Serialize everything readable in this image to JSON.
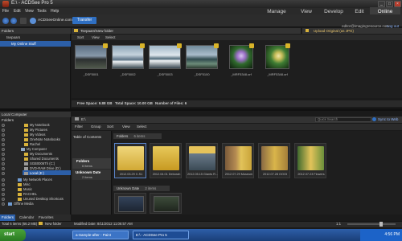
{
  "window": {
    "title": "E:\\ - ACDSee Pro 5"
  },
  "menu": [
    "File",
    "Edit",
    "View",
    "Tools",
    "Help"
  ],
  "modes": [
    "Manage",
    "View",
    "Develop",
    "Edit",
    "Online"
  ],
  "toolbar": {
    "site": "ACDSeeOnline.com",
    "transfer": "Transfer"
  },
  "account": {
    "email": "editor@imagingresource.com",
    "logout": "Log out"
  },
  "online": {
    "panel_title": "Folders",
    "root": "tsepaars",
    "selected_folder": "My Online Stuff",
    "path": "Tsepaars\\New folder",
    "upload_mode": "Upload Original (as JPG)",
    "subbar": [
      "Sort",
      "View",
      "Select"
    ],
    "photos": [
      {
        "name": "_DSF5001"
      },
      {
        "name": "_DSF5002"
      },
      {
        "name": "_DSF5003"
      },
      {
        "name": "_DSF5100"
      },
      {
        "name": "_MRF5348.orf"
      },
      {
        "name": "_MRF5348.orf"
      }
    ],
    "status": {
      "free": "Free Space: 9.88 GB",
      "total": "Total Space: 10.00 GB",
      "files": "Number of Files: 6"
    }
  },
  "local": {
    "header": "Local Computer",
    "folders_label": "Folders",
    "tree": [
      "My Notebook",
      "My Pictures",
      "My Videos",
      "OneNote Notebooks",
      "Rachel",
      "My Computer",
      "My Documents",
      "Shared Documents",
      "SGB0006Th (C:)",
      "DVD-RAM Drive (D:)",
      "Local (E:)",
      "My Network Places",
      "Misc",
      "Music",
      "RACHEL",
      "Unused Desktop Shortcuts",
      "Offline Media"
    ],
    "tabs": [
      "Folders",
      "Calendar",
      "Favorites"
    ]
  },
  "browser": {
    "path": "E:\\",
    "quick_search": "Quick Search",
    "sync": "Sync to Web",
    "filter_bar": [
      "Filter",
      "Group",
      "Sort",
      "View",
      "Select"
    ],
    "toc_title": "Table of Contents",
    "toc_groups": [
      {
        "label": "Folders",
        "count": "6 items"
      },
      {
        "label": "Unknown Date",
        "count": "2 items"
      }
    ],
    "group_folders": {
      "label": "Folders",
      "count": "6 items"
    },
    "folders": [
      "2012.03.29 X-S1",
      "2012.04.01 Deborah",
      "2012.05.15 Giants R...",
      "2012.07.29 Museum",
      "2012.07.28 OOOt",
      "2012.07.23 Flowers"
    ],
    "group_unknown": {
      "label": "Unknown Date",
      "count": "2 items"
    }
  },
  "status_bar": {
    "total": "Total 6 items (66.2 MB)",
    "item": "New folder",
    "modified": "Modified Date: 8/11/2012 11:06:57 AM",
    "zoom": "1:1"
  },
  "taskbar": {
    "start": "start",
    "tasks": [
      "a-Sample-after - Paint",
      "E:\\ - ACDSee Pro 5"
    ],
    "time": "4:56 PM"
  },
  "colors": {
    "accent": "#2c5fa8",
    "folder": "#d8b23b",
    "taskbar": "#1a3f78"
  }
}
